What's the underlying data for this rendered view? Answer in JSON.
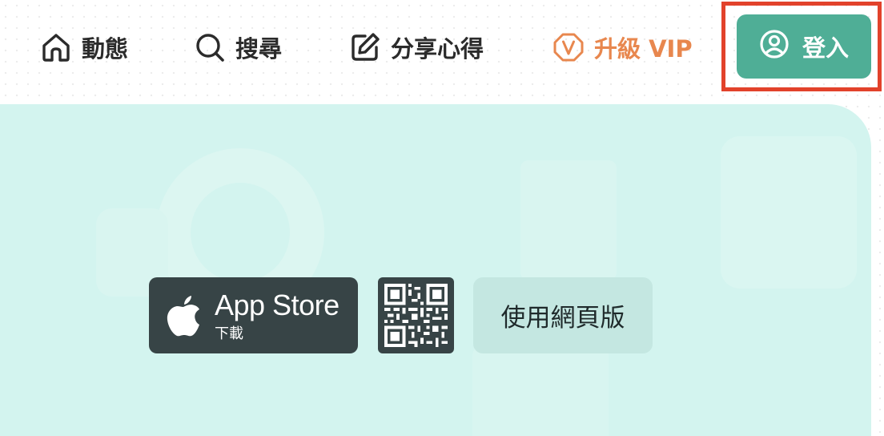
{
  "nav": {
    "feed": {
      "label": "動態",
      "icon": "home-icon"
    },
    "search": {
      "label": "搜尋",
      "icon": "search-icon"
    },
    "share": {
      "label": "分享心得",
      "icon": "edit-icon"
    },
    "vip": {
      "label": "升級 VIP",
      "icon": "vip-badge-icon",
      "color": "#e8874e"
    },
    "login": {
      "label": "登入",
      "icon": "user-circle-icon",
      "color": "#4fae96"
    }
  },
  "highlight_color": "#e2422b",
  "hero": {
    "background": "#d3f4ef",
    "app_store": {
      "title": "App Store",
      "subtitle": "下載",
      "icon": "apple-icon"
    },
    "qr": {
      "icon": "qr-code-icon"
    },
    "web_button": {
      "label": "使用網頁版"
    }
  }
}
